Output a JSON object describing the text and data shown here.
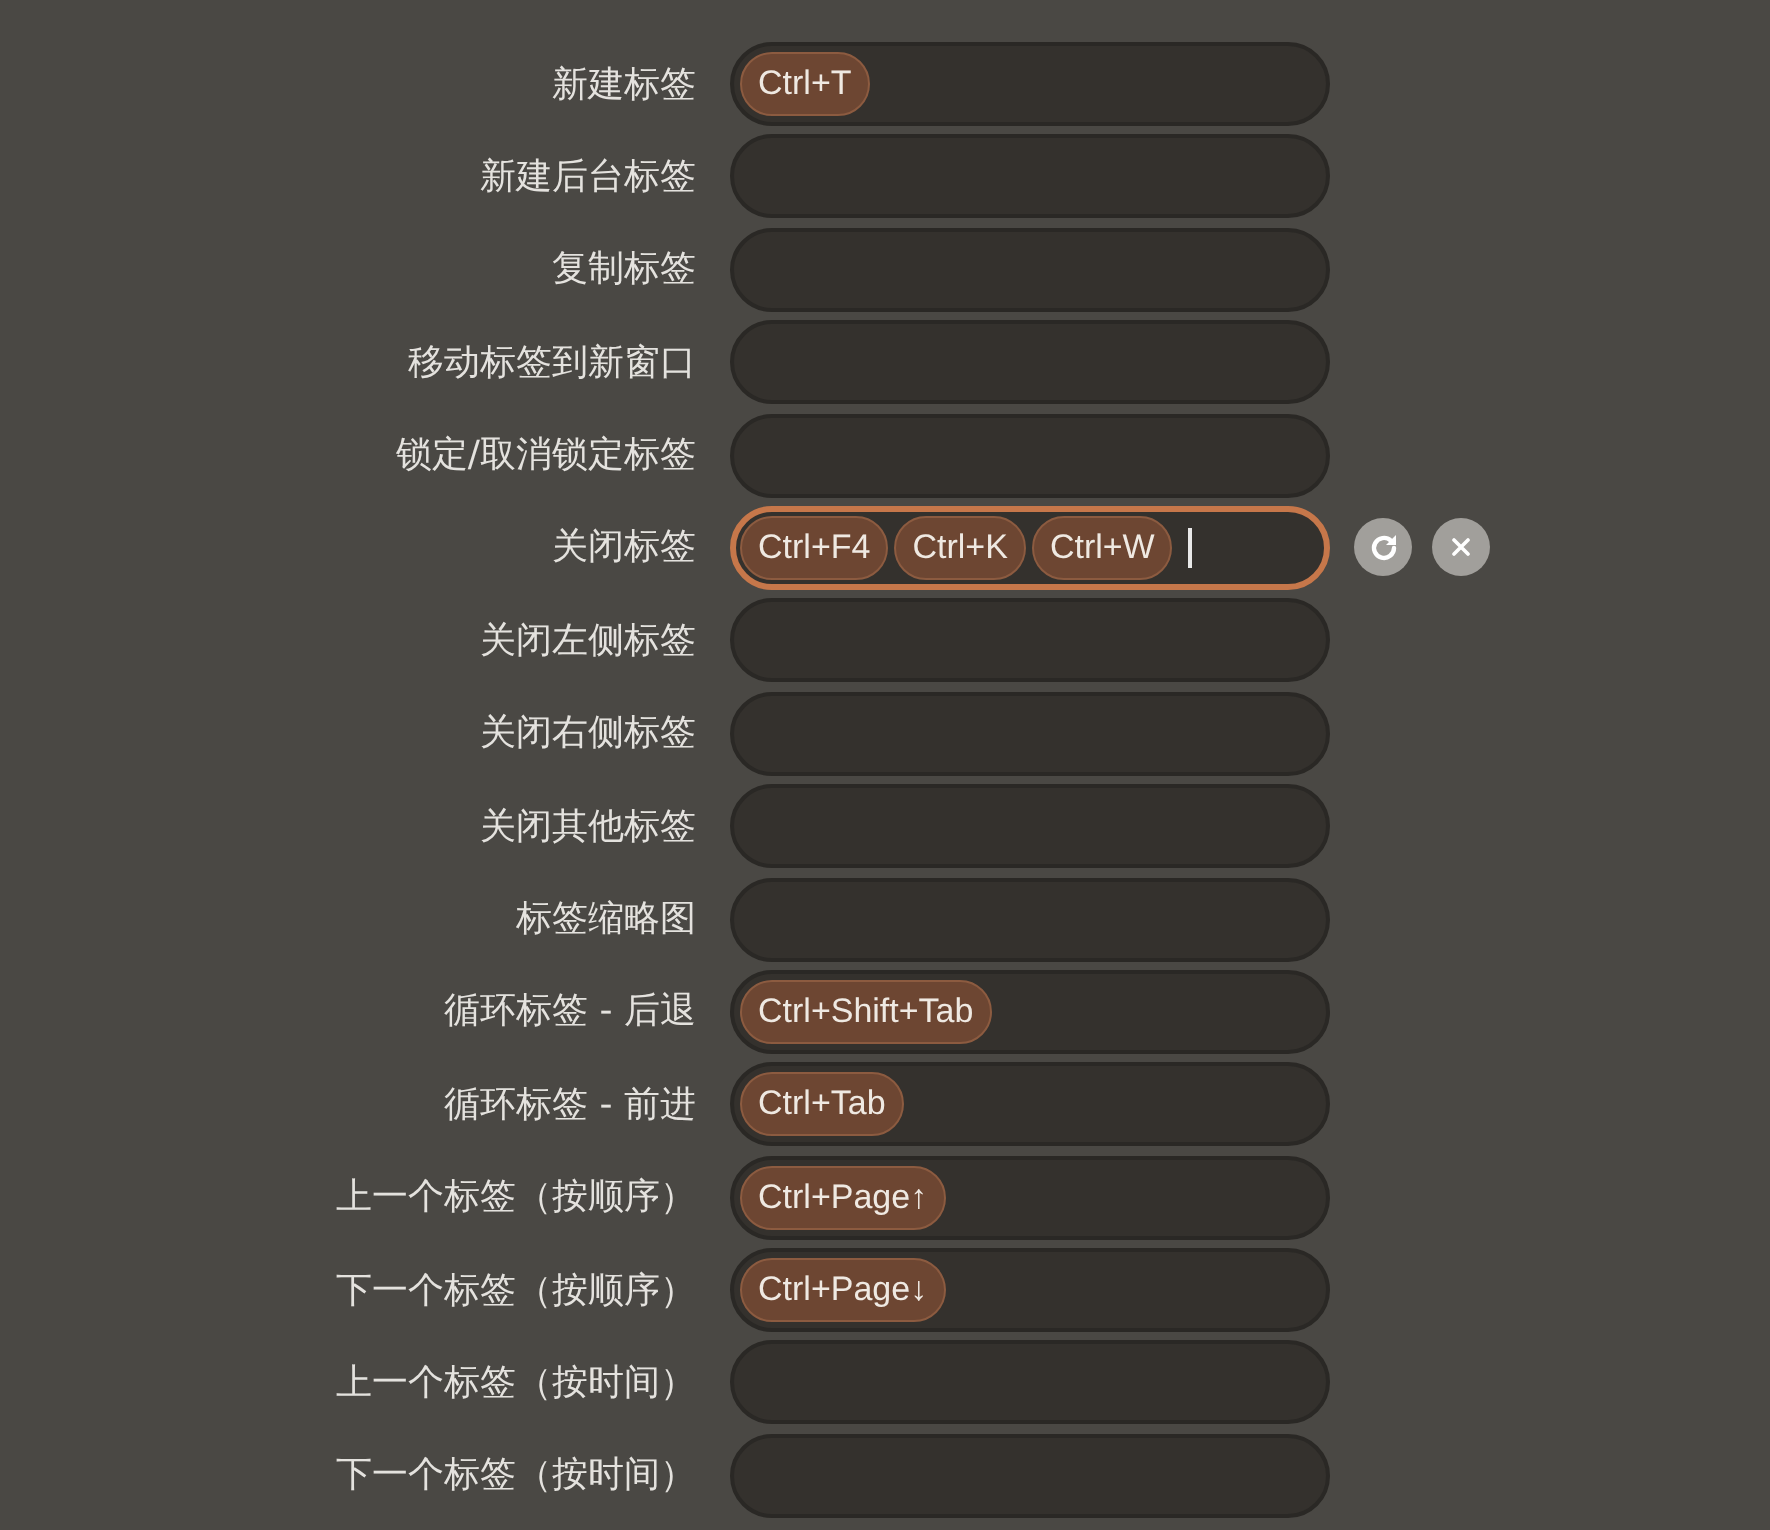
{
  "shortcuts": [
    {
      "label": "新建标签",
      "keys": [
        "Ctrl+T"
      ],
      "focused": false
    },
    {
      "label": "新建后台标签",
      "focused": false
    },
    {
      "label": "复制标签",
      "focused": false
    },
    {
      "label": "移动标签到新窗口",
      "focused": false
    },
    {
      "label": "锁定/取消锁定标签",
      "focused": false
    },
    {
      "label": "关闭标签",
      "keys": [
        "Ctrl+F4",
        "Ctrl+K",
        "Ctrl+W"
      ],
      "focused": true
    },
    {
      "label": "关闭左侧标签",
      "focused": false
    },
    {
      "label": "关闭右侧标签",
      "focused": false
    },
    {
      "label": "关闭其他标签",
      "focused": false
    },
    {
      "label": "标签缩略图",
      "focused": false
    },
    {
      "label": "循环标签 - 后退",
      "keys": [
        "Ctrl+Shift+Tab"
      ],
      "focused": false
    },
    {
      "label": "循环标签 - 前进",
      "keys": [
        "Ctrl+Tab"
      ],
      "focused": false
    },
    {
      "label": "上一个标签（按顺序）",
      "keys": [
        "Ctrl+Page↑"
      ],
      "focused": false
    },
    {
      "label": "下一个标签（按顺序）",
      "keys": [
        "Ctrl+Page↓"
      ],
      "focused": false
    },
    {
      "label": "上一个标签（按时间）",
      "focused": false
    },
    {
      "label": "下一个标签（按时间）",
      "focused": false
    }
  ]
}
